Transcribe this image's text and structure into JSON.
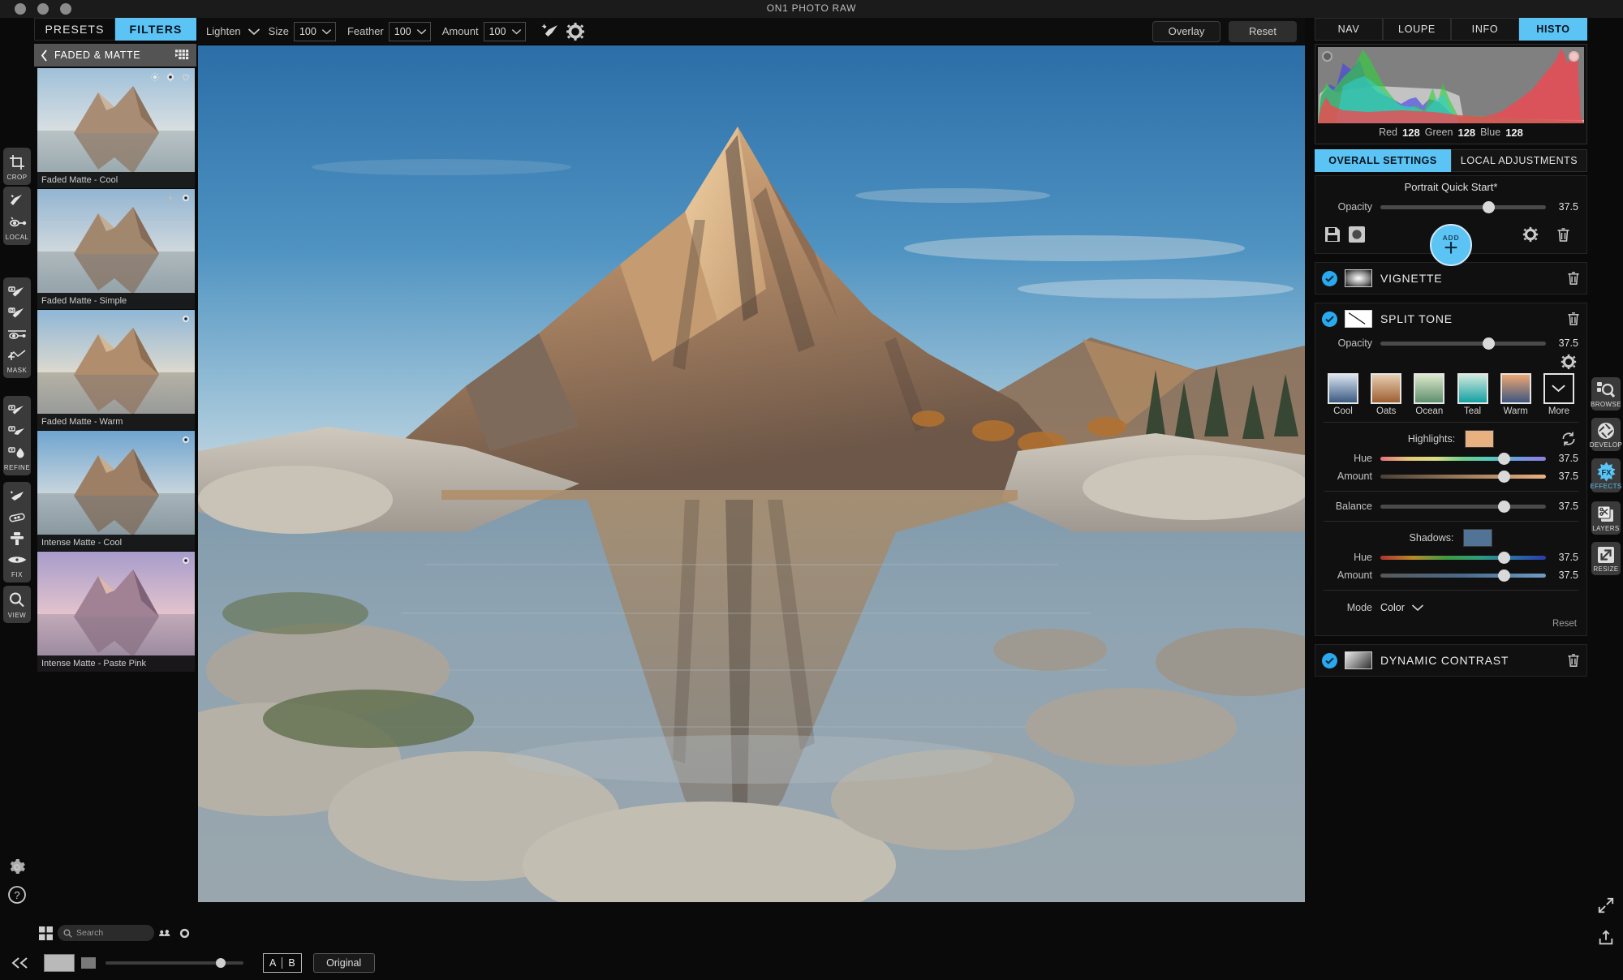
{
  "titlebar": {
    "title": "ON1 PHOTO RAW"
  },
  "left_tools": [
    {
      "name": "crop",
      "label": "CROP",
      "icons": [
        "crop-icon"
      ]
    },
    {
      "name": "local",
      "label": "LOCAL",
      "icons": [
        "adjustment-brush-icon",
        "adjustable-gradient-icon"
      ]
    },
    {
      "name": "mask",
      "label": "MASK",
      "icons": [
        "masking-brush-icon",
        "masking-bug-icon",
        "gradient-mask-icon",
        "chisel-icon"
      ]
    },
    {
      "name": "refine",
      "label": "REFINE",
      "icons": [
        "refine-brush-icon",
        "chisel-tool-icon",
        "blur-tool-icon"
      ]
    },
    {
      "name": "fix",
      "label": "FIX",
      "icons": [
        "perfect-eraser-icon",
        "retouch-brush-icon",
        "clone-stamp-icon",
        "red-eye-icon"
      ]
    },
    {
      "name": "view",
      "label": "VIEW",
      "icons": [
        "zoom-tool-icon"
      ]
    }
  ],
  "left_panel": {
    "tabs": [
      {
        "label": "PRESETS",
        "active": false
      },
      {
        "label": "FILTERS",
        "active": true
      }
    ],
    "category": "FADED & MATTE",
    "presets": [
      {
        "label": "Faded Matte - Cool",
        "selected": true,
        "badges": [
          "settings-icon",
          "gear-icon",
          "favorite-icon"
        ]
      },
      {
        "label": "Faded Matte - Simple",
        "selected": false,
        "badges": [
          "settings-icon",
          "gear-icon"
        ]
      },
      {
        "label": "Faded Matte - Warm",
        "selected": false,
        "badges": [
          "gear-icon"
        ]
      },
      {
        "label": "Intense Matte - Cool",
        "selected": false,
        "badges": [
          "gear-icon"
        ]
      },
      {
        "label": "Intense Matte - Paste Pink",
        "selected": false,
        "badges": [
          "gear-icon"
        ]
      }
    ],
    "search_placeholder": "Search"
  },
  "options_bar": {
    "mode": "Lighten",
    "fields": [
      {
        "label": "Size",
        "value": "100"
      },
      {
        "label": "Feather",
        "value": "100"
      },
      {
        "label": "Amount",
        "value": "100"
      }
    ],
    "icons": [
      "brush-icon",
      "gear-icon"
    ],
    "overlay_label": "Overlay",
    "reset_label": "Reset"
  },
  "right_panel": {
    "view_tabs": [
      {
        "label": "NAV",
        "active": false
      },
      {
        "label": "LOUPE",
        "active": false
      },
      {
        "label": "INFO",
        "active": false
      },
      {
        "label": "HISTO",
        "active": true
      }
    ],
    "histogram": {
      "red_label": "Red",
      "red_value": "128",
      "green_label": "Green",
      "green_value": "128",
      "blue_label": "Blue",
      "blue_value": "128"
    },
    "section_tabs": [
      {
        "label": "OVERALL SETTINGS",
        "active": true
      },
      {
        "label": "LOCAL ADJUSTMENTS",
        "active": false
      }
    ],
    "quick_start": {
      "title": "Portrait Quick Start*",
      "opacity_label": "Opacity",
      "opacity_value": "37.5",
      "opacity_pct": 62,
      "add_label": "ADD",
      "icons": [
        "save-icon",
        "mask-preview-icon",
        "gear-icon",
        "trash-icon"
      ]
    },
    "filters": [
      {
        "name": "VIGNETTE",
        "enabled": true,
        "thumb": "vignette-thumb"
      },
      {
        "name": "SPLIT TONE",
        "enabled": true,
        "thumb": "split-tone-thumb"
      },
      {
        "name": "DYNAMIC CONTRAST",
        "enabled": true,
        "thumb": "dynamic-contrast-thumb"
      }
    ],
    "split_tone": {
      "opacity_label": "Opacity",
      "opacity_value": "37.5",
      "opacity_pct": 62,
      "swatches": [
        {
          "name": "Cool",
          "top": "#d8e3ef",
          "bottom": "#3c5a82"
        },
        {
          "name": "Oats",
          "top": "#e7cdb0",
          "bottom": "#9d5f32"
        },
        {
          "name": "Ocean",
          "top": "#dbe8cb",
          "bottom": "#5f8f6d"
        },
        {
          "name": "Teal",
          "top": "#cfe9dd",
          "bottom": "#14a0a2"
        },
        {
          "name": "Warm",
          "top": "#eda773",
          "bottom": "#3f5680"
        },
        {
          "name": "More",
          "top": "",
          "bottom": ""
        }
      ],
      "highlights_label": "Highlights:",
      "highlights_color": "#e8b182",
      "highlights_hue_label": "Hue",
      "highlights_hue_value": "37.5",
      "highlights_hue_pct": 72,
      "highlights_amount_label": "Amount",
      "highlights_amount_value": "37.5",
      "highlights_amount_pct": 72,
      "balance_label": "Balance",
      "balance_value": "37.5",
      "balance_pct": 72,
      "shadows_label": "Shadows:",
      "shadows_color": "#517396",
      "shadows_hue_label": "Hue",
      "shadows_hue_value": "37.5",
      "shadows_hue_pct": 72,
      "shadows_amount_label": "Amount",
      "shadows_amount_value": "37.5",
      "shadows_amount_pct": 72,
      "mode_label": "Mode",
      "mode_value": "Color",
      "reset_label": "Reset"
    }
  },
  "right_rail": [
    {
      "label": "BROWSE",
      "icon": "browse-icon",
      "active": false
    },
    {
      "label": "DEVELOP",
      "icon": "develop-icon",
      "active": false
    },
    {
      "label": "EFFECTS",
      "icon": "effects-fx-icon",
      "active": true
    },
    {
      "label": "LAYERS",
      "icon": "layers-icon",
      "active": false
    },
    {
      "label": "RESIZE",
      "icon": "resize-icon",
      "active": false
    }
  ],
  "bottom_bar": {
    "compare_a": "A",
    "compare_b": "B",
    "original_label": "Original",
    "zoom_pct": 80
  },
  "colors": {
    "accent": "#5cc3f5",
    "panel_bg": "#0a0a0a",
    "tool_group": "#3a3a3a"
  }
}
